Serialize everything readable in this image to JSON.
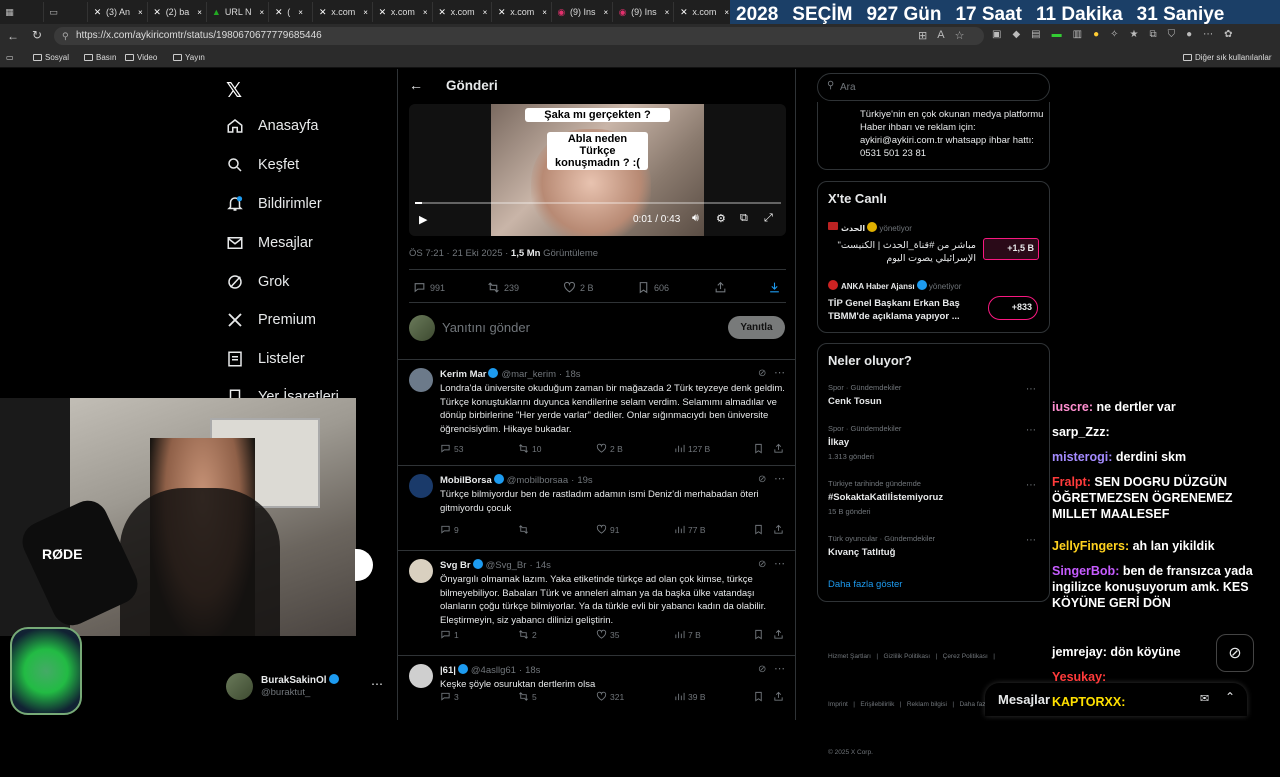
{
  "browser": {
    "tabs": [
      {
        "icon": "app-icon",
        "label": ""
      },
      {
        "icon": "tab-icon",
        "label": ""
      },
      {
        "icon": "x-logo-icon",
        "label": "(3) An"
      },
      {
        "icon": "x-logo-icon",
        "label": "(2) ba"
      },
      {
        "icon": "green-icon",
        "label": "URL N"
      },
      {
        "icon": "x-logo-icon",
        "label": "("
      },
      {
        "icon": "x-logo-icon",
        "label": "x.com"
      },
      {
        "icon": "x-logo-icon",
        "label": "x.com"
      },
      {
        "icon": "x-logo-icon",
        "label": "x.com"
      },
      {
        "icon": "x-logo-icon",
        "label": "x.com"
      },
      {
        "icon": "instagram-icon",
        "label": "(9) Ins"
      },
      {
        "icon": "instagram-icon",
        "label": "(9) Ins"
      },
      {
        "icon": "x-logo-icon",
        "label": "x.com"
      },
      {
        "icon": "x-logo-icon",
        "label": "x.com"
      },
      {
        "icon": "x-logo-icon",
        "label": "x.com"
      },
      {
        "icon": "x-logo-icon",
        "label": "x.com"
      },
      {
        "icon": "x-logo-icon",
        "label": "x.com"
      }
    ],
    "url": "https://x.com/aykiricomtr/status/1980670677779685446",
    "bookmarks": [
      "Sosyal",
      "Basın",
      "Video",
      "Yayın"
    ],
    "other_bookmarks": "Diğer sık kullanılanlar"
  },
  "countdown": {
    "year": "2028",
    "label": "SEÇİM",
    "days": "927",
    "days_label": "Gün",
    "hours": "17",
    "hours_label": "Saat",
    "minutes": "11",
    "minutes_label": "Dakika",
    "seconds": "31",
    "seconds_label": "Saniye"
  },
  "nav": {
    "items": [
      {
        "icon": "home-icon",
        "label": "Anasayfa"
      },
      {
        "icon": "search-icon",
        "label": "Keşfet"
      },
      {
        "icon": "bell-icon",
        "label": "Bildirimler"
      },
      {
        "icon": "mail-icon",
        "label": "Mesajlar"
      },
      {
        "icon": "grok-icon",
        "label": "Grok"
      },
      {
        "icon": "x-logo-icon",
        "label": "Premium"
      },
      {
        "icon": "list-icon",
        "label": "Listeler"
      },
      {
        "icon": "bookmark-icon",
        "label": "Yer İşaretleri"
      }
    ],
    "account": {
      "name": "BurakSakinOl",
      "handle": "@buraktut_"
    }
  },
  "post": {
    "header_title": "Gönderi",
    "caption_1": "Şaka mı gerçekten ?",
    "caption_2": "Abla neden Türkçe konuşmadın ? :(",
    "video_time": "0:01 / 0:43",
    "video_progress": 0.02,
    "timestamp": "ÖS 7:21 · 21 Eki 2025 ·",
    "views": "1,5 Mn",
    "views_label": "Görüntüleme",
    "replies": "991",
    "reposts": "239",
    "likes": "2 B",
    "bookmarks": "606",
    "reply_placeholder": "Yanıtını gönder",
    "reply_button": "Yanıtla"
  },
  "replies": [
    {
      "name": "Kerim Mar",
      "handle": "@mar_kerim",
      "time": "18s",
      "text": "Londra'da üniversite okuduğum zaman bir mağazada 2 Türk teyzeye denk geldim. Türkçe konuştuklarını duyunca kendilerine selam verdim. Selamımı almadılar ve dönüp birbirlerine \"Her yerde varlar\" dediler. Onlar sığınmacıydı ben üniversite öğrencisiydim. Hikaye bukadar.",
      "replies": "53",
      "reposts": "10",
      "likes": "2 B",
      "views": "127 B"
    },
    {
      "name": "MobilBorsa",
      "handle": "@mobilborsaa",
      "time": "19s",
      "text": "Türkçe bilmiyordur ben de rastladım adamın ismi Deniz'di merhabadan öteri gitmiyordu çocuk",
      "replies": "9",
      "reposts": "",
      "likes": "91",
      "views": "77 B"
    },
    {
      "name": "Svg Br",
      "handle": "@Svg_Br",
      "time": "14s",
      "text": "Önyargılı olmamak lazım. Yaka etiketinde türkçe ad olan çok kimse, türkçe bilmeyebiliyor. Babaları Türk ve anneleri alman ya da başka ülke vatandaşı olanların çoğu türkçe bilmiyorlar. Ya da türkle evli bir yabancı kadın da olabilir. Eleştirmeyin, siz yabancı dilinizi geliştirin.",
      "replies": "1",
      "reposts": "2",
      "likes": "35",
      "views": "7 B"
    },
    {
      "name": "|61|",
      "handle": "@4asllg61",
      "time": "18s",
      "text": "Keşke şöyle osuruktan dertlerim olsa",
      "replies": "3",
      "reposts": "5",
      "likes": "321",
      "views": "39 B"
    }
  ],
  "right": {
    "search_placeholder": "Ara",
    "bio": "Türkiye'nin en çok okunan medya platformu Haber ihbarı ve reklam için: aykiri@aykiri.com.tr whatsapp ihbar hattı: 0531 501 23 81",
    "live_title": "X'te Canlı",
    "live": [
      {
        "host": "الحدث",
        "role": "yönetiyor",
        "title": "مباشر من #قناة_الحدث | الكنيست\" الإسرائيلي يصوت اليوم",
        "count": "+1,5 B"
      },
      {
        "host": "ANKA Haber Ajansı",
        "role": "yönetiyor",
        "title": "TİP Genel Başkanı Erkan Baş TBMM'de açıklama yapıyor ...",
        "count": "+833"
      }
    ],
    "trends_title": "Neler oluyor?",
    "trends": [
      {
        "category": "Spor · Gündemdekiler",
        "name": "Cenk Tosun",
        "count": ""
      },
      {
        "category": "Spor · Gündemdekiler",
        "name": "İlkay",
        "count": "1.313 gönderi"
      },
      {
        "category": "Türkiye tarihinde gündemde",
        "name": "#SokaktaKatilİstemiyoruz",
        "count": "15 B gönderi"
      },
      {
        "category": "Türk oyuncular · Gündemdekiler",
        "name": "Kıvanç Tatlıtuğ",
        "count": ""
      }
    ],
    "show_more": "Daha fazla göster",
    "footer_1": "Hizmet Şartları   |   Gizlilik Politikası   |   Çerez Politikası   |",
    "footer_2": "Imprint   |   Erişilebilirlik   |   Reklam bilgisi   |   Daha fazla ...",
    "footer_3": "© 2025 X Corp.",
    "messages_label": "Mesajlar"
  },
  "chat": [
    {
      "user": "iuscre:",
      "text": "ne dertler var",
      "color": "#ff8fd0"
    },
    {
      "user": "sarp_Zzz:",
      "text": "",
      "color": "#ffffff"
    },
    {
      "user": "misterogi:",
      "text": "derdini skm",
      "color": "#a48bff"
    },
    {
      "user": "Fralpt:",
      "text": "SEN DOGRU DÜZGÜN ÖĞRETMEZSEN ÖGRENEMEZ MILLET MAALESEF",
      "color": "#ff3b3b"
    },
    {
      "user": "JellyFingers:",
      "text": "ah lan yikildik",
      "color": "#ffd21f"
    },
    {
      "user": "SingerBob:",
      "text": "ben de fransızca yada ingilizce konuşuyorum amk. KES KÖYÜNE GERİ DÖN",
      "color": "#c65cff"
    },
    {
      "user": "jemrejay:",
      "text": "dön köyüne",
      "color": "#ffffff"
    },
    {
      "user": "Yesukay:",
      "text": "",
      "color": "#ff3b3b"
    },
    {
      "user": "KAPTORXX:",
      "text": "",
      "color": "#ffe000"
    }
  ],
  "webcam": {
    "mic_brand": "RØDE"
  }
}
